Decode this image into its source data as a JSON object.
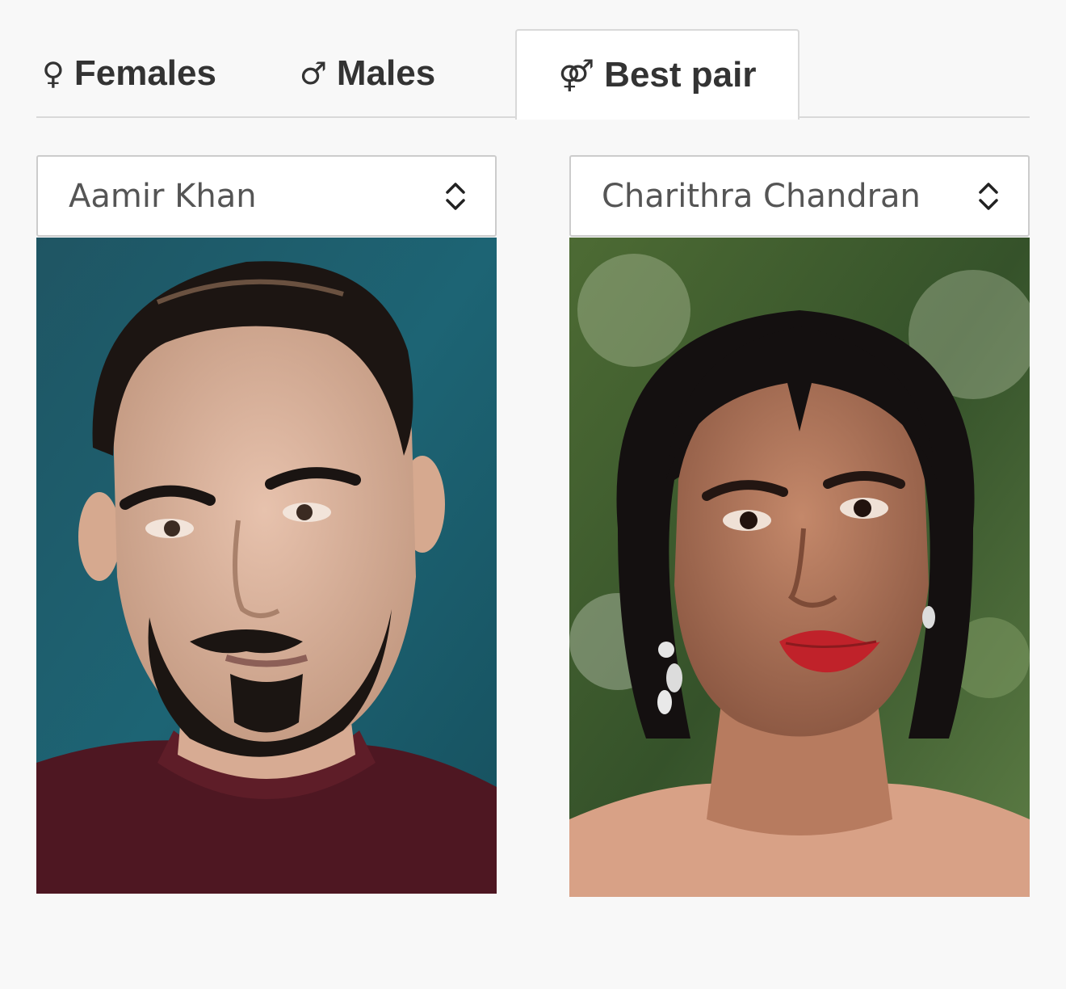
{
  "tabs": [
    {
      "label": "Females",
      "symbol": "♀",
      "active": false
    },
    {
      "label": "Males",
      "symbol": "♂",
      "active": false
    },
    {
      "label": "Best pair",
      "symbol": "⚤",
      "active": true
    }
  ],
  "left_select": {
    "value": "Aamir Khan"
  },
  "right_select": {
    "value": "Charithra Chandran"
  },
  "colors": {
    "page_bg": "#f8f8f8",
    "tab_text": "#333333",
    "border": "#d9d9d9",
    "select_text": "#555555"
  }
}
